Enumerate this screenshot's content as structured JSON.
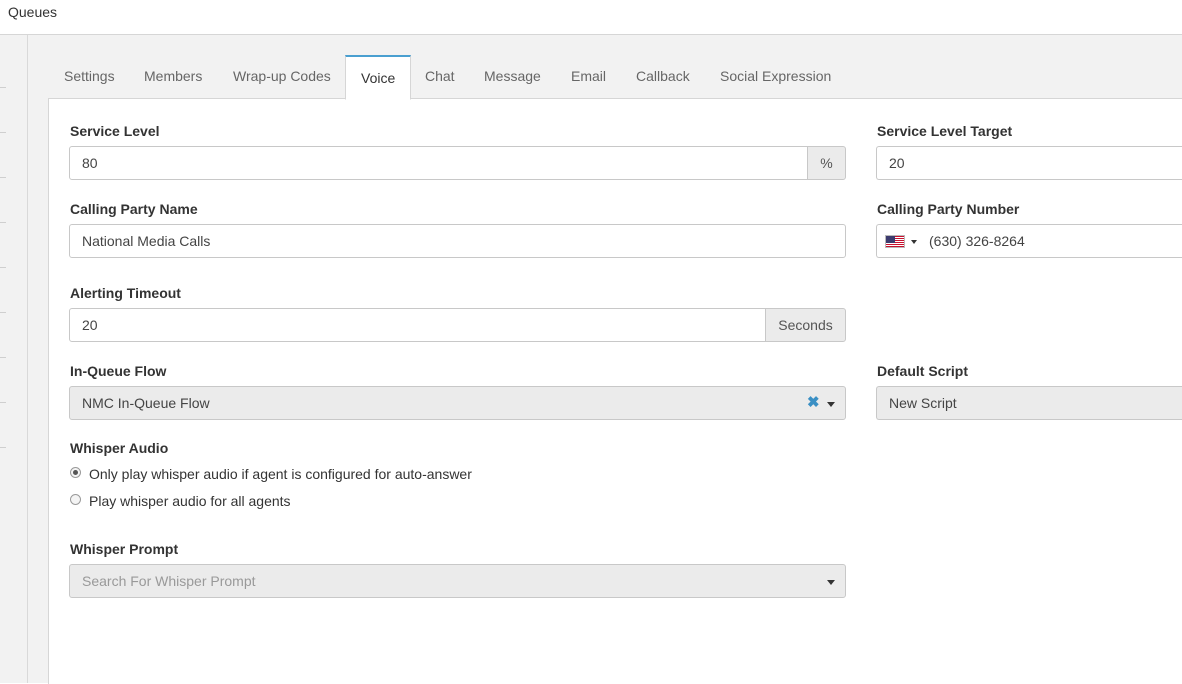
{
  "header": {
    "title": "Queues"
  },
  "tabs": [
    {
      "label": "Settings",
      "active": false
    },
    {
      "label": "Members",
      "active": false
    },
    {
      "label": "Wrap-up Codes",
      "active": false
    },
    {
      "label": "Voice",
      "active": true
    },
    {
      "label": "Chat",
      "active": false
    },
    {
      "label": "Message",
      "active": false
    },
    {
      "label": "Email",
      "active": false
    },
    {
      "label": "Callback",
      "active": false
    },
    {
      "label": "Social Expression",
      "active": false
    }
  ],
  "form": {
    "service_level": {
      "label": "Service Level",
      "value": "80",
      "unit": "%"
    },
    "service_level_target": {
      "label": "Service Level Target",
      "value": "20"
    },
    "calling_party_name": {
      "label": "Calling Party Name",
      "value": "National Media Calls"
    },
    "calling_party_number": {
      "label": "Calling Party Number",
      "value": "(630) 326-8264",
      "country_icon": "us-flag-icon"
    },
    "alerting_timeout": {
      "label": "Alerting Timeout",
      "value": "20",
      "unit": "Seconds"
    },
    "in_queue_flow": {
      "label": "In-Queue Flow",
      "value": "NMC In-Queue Flow"
    },
    "default_script": {
      "label": "Default Script",
      "value": "New Script"
    },
    "whisper_audio": {
      "label": "Whisper Audio",
      "options": [
        {
          "label": "Only play whisper audio if agent is configured for auto-answer",
          "checked": true
        },
        {
          "label": "Play whisper audio for all agents",
          "checked": false
        }
      ]
    },
    "whisper_prompt": {
      "label": "Whisper Prompt",
      "placeholder": "Search For Whisper Prompt"
    }
  },
  "colors": {
    "accent": "#4a9fd0",
    "clear_icon": "#3a8fc4",
    "panel_bg": "#f2f2f2"
  }
}
